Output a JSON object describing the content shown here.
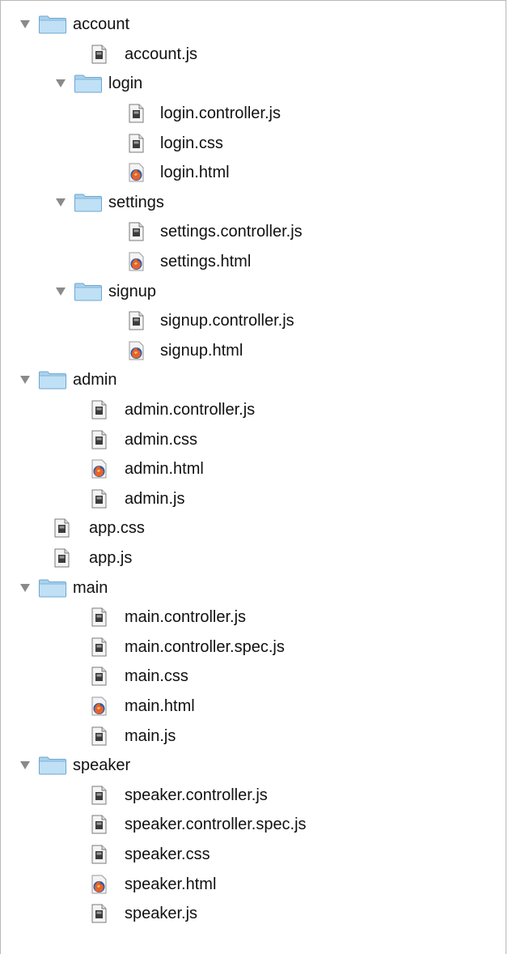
{
  "tree": {
    "rows": [
      {
        "type": "folder",
        "depth": 0,
        "label": "account"
      },
      {
        "type": "file",
        "depth": 1,
        "kind": "text",
        "label": "account.js"
      },
      {
        "type": "folder",
        "depth": 1,
        "label": "login"
      },
      {
        "type": "file",
        "depth": 2,
        "kind": "text",
        "label": "login.controller.js"
      },
      {
        "type": "file",
        "depth": 2,
        "kind": "text",
        "label": "login.css"
      },
      {
        "type": "file",
        "depth": 2,
        "kind": "html",
        "label": "login.html"
      },
      {
        "type": "folder",
        "depth": 1,
        "label": "settings"
      },
      {
        "type": "file",
        "depth": 2,
        "kind": "text",
        "label": "settings.controller.js"
      },
      {
        "type": "file",
        "depth": 2,
        "kind": "html",
        "label": "settings.html"
      },
      {
        "type": "folder",
        "depth": 1,
        "label": "signup"
      },
      {
        "type": "file",
        "depth": 2,
        "kind": "text",
        "label": "signup.controller.js"
      },
      {
        "type": "file",
        "depth": 2,
        "kind": "html",
        "label": "signup.html"
      },
      {
        "type": "folder",
        "depth": 0,
        "label": "admin"
      },
      {
        "type": "file",
        "depth": 1,
        "kind": "text",
        "label": "admin.controller.js"
      },
      {
        "type": "file",
        "depth": 1,
        "kind": "text",
        "label": "admin.css"
      },
      {
        "type": "file",
        "depth": 1,
        "kind": "html",
        "label": "admin.html"
      },
      {
        "type": "file",
        "depth": 1,
        "kind": "text",
        "label": "admin.js"
      },
      {
        "type": "file",
        "depth": 0,
        "kind": "text",
        "label": "app.css"
      },
      {
        "type": "file",
        "depth": 0,
        "kind": "text",
        "label": "app.js"
      },
      {
        "type": "folder",
        "depth": 0,
        "label": "main"
      },
      {
        "type": "file",
        "depth": 1,
        "kind": "text",
        "label": "main.controller.js"
      },
      {
        "type": "file",
        "depth": 1,
        "kind": "text",
        "label": "main.controller.spec.js"
      },
      {
        "type": "file",
        "depth": 1,
        "kind": "text",
        "label": "main.css"
      },
      {
        "type": "file",
        "depth": 1,
        "kind": "html",
        "label": "main.html"
      },
      {
        "type": "file",
        "depth": 1,
        "kind": "text",
        "label": "main.js"
      },
      {
        "type": "folder",
        "depth": 0,
        "label": "speaker"
      },
      {
        "type": "file",
        "depth": 1,
        "kind": "text",
        "label": "speaker.controller.js"
      },
      {
        "type": "file",
        "depth": 1,
        "kind": "text",
        "label": "speaker.controller.spec.js"
      },
      {
        "type": "file",
        "depth": 1,
        "kind": "text",
        "label": "speaker.css"
      },
      {
        "type": "file",
        "depth": 1,
        "kind": "html",
        "label": "speaker.html"
      },
      {
        "type": "file",
        "depth": 1,
        "kind": "text",
        "label": "speaker.js"
      }
    ]
  },
  "icons": {
    "folder": "folder-icon",
    "text_file": "text-file-icon",
    "html_file": "html-file-icon",
    "disclosure": "disclosure-triangle-expanded-icon"
  },
  "colors": {
    "folder_fill": "#a9d2ee",
    "folder_stroke": "#6fa6cf",
    "disclosure": "#8a8a8a",
    "html_orange": "#e8612c",
    "html_blue": "#2b5ea7"
  }
}
